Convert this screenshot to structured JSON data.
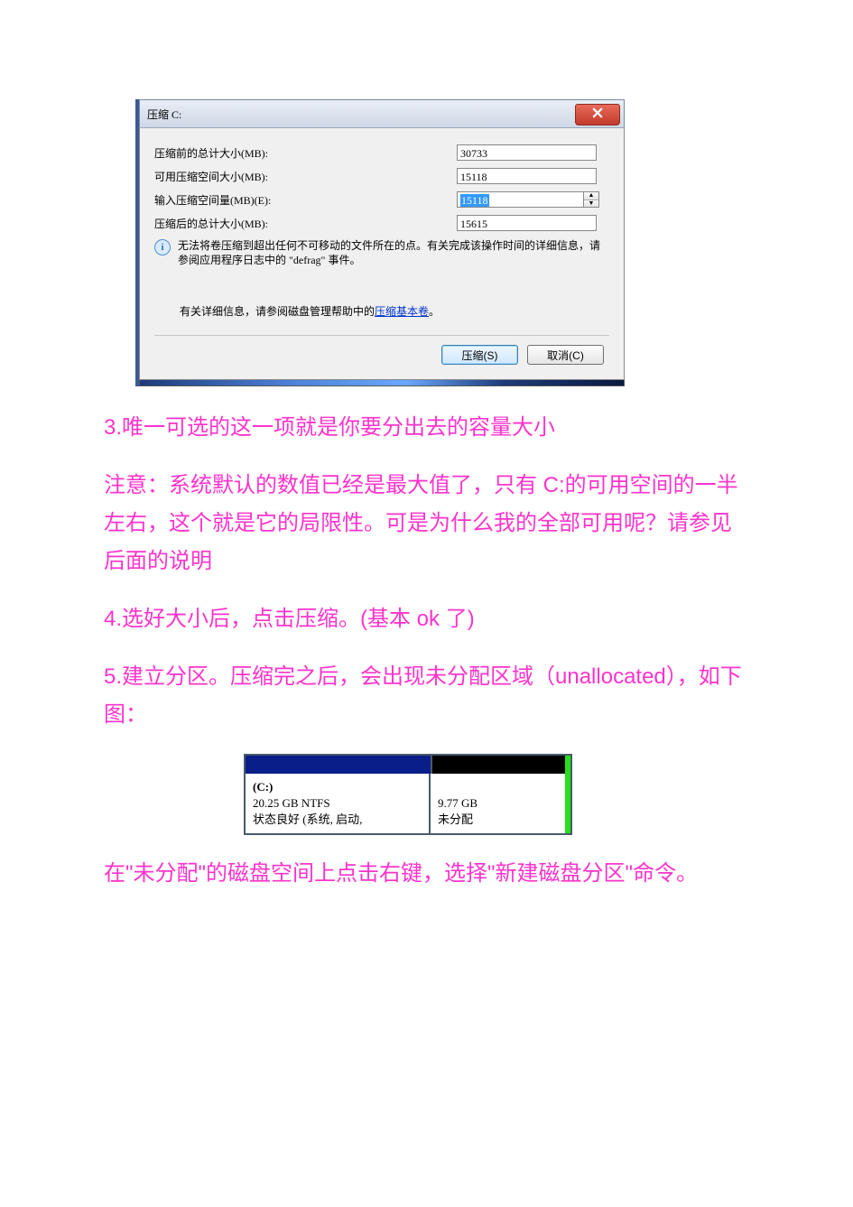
{
  "dialog": {
    "title": "压缩 C:",
    "rows": {
      "before_label": "压缩前的总计大小(MB):",
      "before_value": "30733",
      "avail_label": "可用压缩空间大小(MB):",
      "avail_value": "15118",
      "input_label": "输入压缩空间量(MB)(E):",
      "input_value": "15118",
      "after_label": "压缩后的总计大小(MB):",
      "after_value": "15615"
    },
    "info_text": "无法将卷压缩到超出任何不可移动的文件所在的点。有关完成该操作时间的详细信息，请参阅应用程序日志中的 \"defrag\" 事件。",
    "help_prefix": "有关详细信息，请参阅磁盘管理帮助中的",
    "help_link": "压缩基本卷",
    "help_suffix": "。",
    "btn_shrink": "压缩(S)",
    "btn_cancel": "取消(C)"
  },
  "paragraphs": {
    "p3": "3.唯一可选的这一项就是你要分出去的容量大小",
    "note": "注意：系统默认的数值已经是最大值了，只有 C:的可用空间的一半左右，这个就是它的局限性。可是为什么我的全部可用呢？请参见后面的说明",
    "p4": "4.选好大小后，点击压缩。(基本 ok 了)",
    "p5": "5.建立分区。压缩完之后，会出现未分配区域（unallocated），如下图：",
    "p_last": "在\"未分配\"的磁盘空间上点击右键，选择\"新建磁盘分区\"命令。"
  },
  "disk": {
    "c_label": "(C:)",
    "c_size": "20.25 GB NTFS",
    "c_status": "状态良好 (系统, 启动,",
    "un_size": "9.77 GB",
    "un_label": "未分配"
  }
}
